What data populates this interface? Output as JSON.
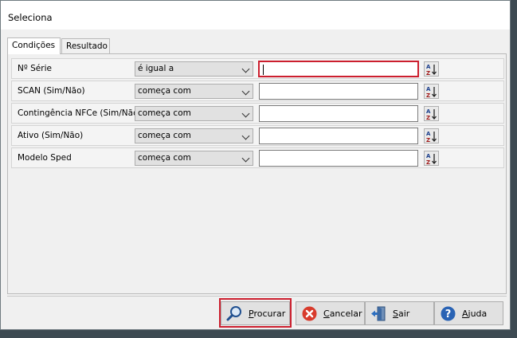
{
  "window": {
    "title": "Seleciona"
  },
  "tabs": [
    {
      "label": "Condições",
      "active": true
    },
    {
      "label": "Resultado",
      "active": false
    }
  ],
  "conditions": [
    {
      "label": "Nº Série",
      "operator": "é igual a",
      "value": ""
    },
    {
      "label": "SCAN (Sim/Não)",
      "operator": "começa com",
      "value": ""
    },
    {
      "label": "Contingência NFCe (Sim/Não)",
      "operator": "começa com",
      "value": ""
    },
    {
      "label": "Ativo (Sim/Não)",
      "operator": "começa com",
      "value": ""
    },
    {
      "label": "Modelo Sped",
      "operator": "começa com",
      "value": ""
    }
  ],
  "buttons": {
    "procurar": {
      "first": "P",
      "rest": "rocurar",
      "icon": "magnifier-icon"
    },
    "cancelar": {
      "first": "C",
      "rest": "ancelar",
      "icon": "cancel-icon"
    },
    "sair": {
      "first": "S",
      "rest": "air",
      "icon": "exit-door-icon"
    },
    "ajuda": {
      "first": "A",
      "rest": "juda",
      "icon": "help-icon"
    }
  },
  "colors": {
    "highlight": "#cc1f2e",
    "window_bg": "#f0f0f0",
    "desktop_bg": "#3d4a52"
  }
}
